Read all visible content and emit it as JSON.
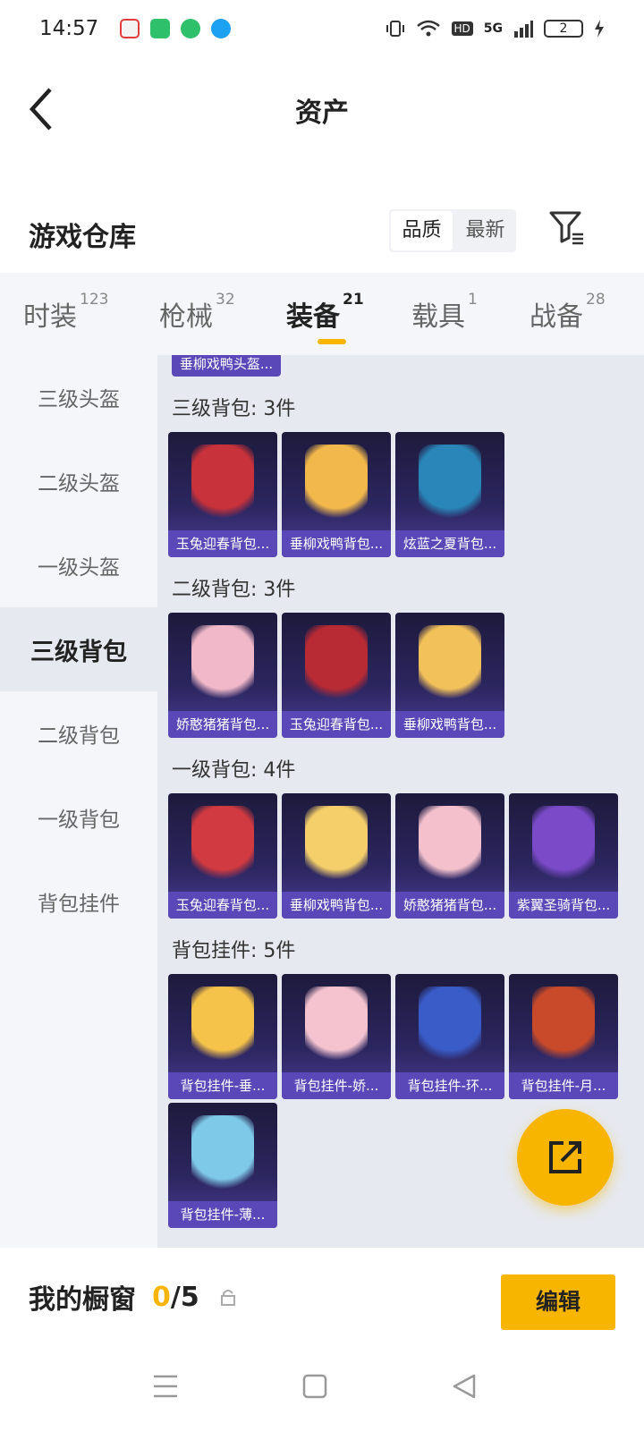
{
  "status_bar": {
    "time": "14:57",
    "network_label": "5G",
    "hd_label": "HD",
    "battery": "2"
  },
  "header": {
    "title": "资产"
  },
  "warehouse": {
    "title": "游戏仓库",
    "sort_options": [
      "品质",
      "最新"
    ],
    "active_sort": "品质"
  },
  "tabs": [
    {
      "label": "时装",
      "count": "123"
    },
    {
      "label": "枪械",
      "count": "32"
    },
    {
      "label": "装备",
      "count": "21"
    },
    {
      "label": "载具",
      "count": "1"
    },
    {
      "label": "战备",
      "count": "28"
    }
  ],
  "active_tab": "装备",
  "categories": [
    "三级头盔",
    "二级头盔",
    "一级头盔",
    "三级背包",
    "二级背包",
    "一级背包",
    "背包挂件"
  ],
  "active_category": "三级背包",
  "partial_item_label": "垂柳戏鸭头盔...",
  "sections": [
    {
      "title": "三级背包: 3件",
      "items": [
        {
          "label": "玉兔迎春背包...",
          "color": "#c8323a"
        },
        {
          "label": "垂柳戏鸭背包...",
          "color": "#f2b84b"
        },
        {
          "label": "炫蓝之夏背包...",
          "color": "#2a86b8"
        }
      ]
    },
    {
      "title": "二级背包: 3件",
      "items": [
        {
          "label": "娇憨猪猪背包...",
          "color": "#f0b8c8"
        },
        {
          "label": "玉兔迎春背包...",
          "color": "#b82a34"
        },
        {
          "label": "垂柳戏鸭背包...",
          "color": "#f3c15a"
        }
      ]
    },
    {
      "title": "一级背包: 4件",
      "items": [
        {
          "label": "玉兔迎春背包...",
          "color": "#d03a40"
        },
        {
          "label": "垂柳戏鸭背包...",
          "color": "#f5cf6a"
        },
        {
          "label": "娇憨猪猪背包...",
          "color": "#f3c0cc"
        },
        {
          "label": "紫翼圣骑背包...",
          "color": "#7a4ac8"
        }
      ]
    },
    {
      "title": "背包挂件: 5件",
      "items": [
        {
          "label": "背包挂件-垂...",
          "color": "#f5c24a"
        },
        {
          "label": "背包挂件-娇...",
          "color": "#f4c3cf"
        },
        {
          "label": "背包挂件-环...",
          "color": "#3a5cc8"
        },
        {
          "label": "背包挂件-月...",
          "color": "#c84a2a"
        },
        {
          "label": "背包挂件-薄...",
          "color": "#7ec8e8"
        }
      ]
    }
  ],
  "showcase": {
    "label": "我的橱窗",
    "current": "0",
    "total": "/5",
    "edit_label": "编辑"
  },
  "colors": {
    "accent": "#f7b500",
    "card_label_bg": "#5a48b8"
  }
}
